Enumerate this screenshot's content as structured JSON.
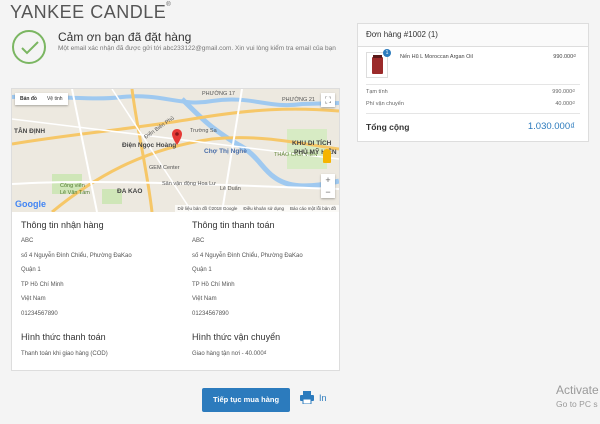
{
  "brand": {
    "logo_text": "YANKEE CANDLE",
    "trademark": "®"
  },
  "confirmation": {
    "title": "Cảm ơn bạn đã đặt hàng",
    "message": "Một email xác nhận đã được gửi tới abc233122@gmail.com. Xin vui lòng kiểm tra email của bạn"
  },
  "map": {
    "tab_map": "Bản đồ",
    "tab_satellite": "Vệ tinh",
    "labels": [
      "PHƯỜNG 17",
      "PHƯỜNG 21",
      "Điện Biên Phủ",
      "Trường Sa",
      "TÂN ĐỊNH",
      "Điện Ngọc Hoàng",
      "Chợ Thị Nghè",
      "KHU DI TÍCH",
      "THẢO CẦM VIÊN",
      "PHỦ MỸ HIỆN",
      "GEM Center",
      "ĐA KAO",
      "Công viên",
      "Lê Văn Tám",
      "Sân vận động Hoa Lư",
      "Lê Duẩn"
    ],
    "zoom_in": "+",
    "zoom_out": "−",
    "google_text": "Google",
    "footer": [
      "Dữ liệu bản đồ ©2018 Google",
      "Điều khoản sử dụng",
      "Báo cáo một lỗi bản đồ"
    ]
  },
  "shipping_info": {
    "title": "Thông tin nhận hàng",
    "name": "ABC",
    "address": "số 4 Nguyễn Đình Chiểu, Phường ĐaKao",
    "district": "Quận 1",
    "city": "TP Hồ Chí Minh",
    "country": "Việt Nam",
    "phone": "01234567890"
  },
  "billing_info": {
    "title": "Thông tin thanh toán",
    "name": "ABC",
    "address": "số 4 Nguyễn Đình Chiểu, Phường ĐaKao",
    "district": "Quận 1",
    "city": "TP Hồ Chí Minh",
    "country": "Việt Nam",
    "phone": "01234567890"
  },
  "payment": {
    "title": "Hình thức thanh toán",
    "value": "Thanh toán khi giao hàng (COD)"
  },
  "delivery": {
    "title": "Hình thức vận chuyển",
    "value": "Giao hàng tận nơi - 40.000₫"
  },
  "actions": {
    "continue_label": "Tiếp tục mua hàng",
    "print_label": "In"
  },
  "order": {
    "title": "Đơn hàng #1002 (1)",
    "item_name": "Nến Hũ L Moroccan Argan Oil",
    "item_price": "990.000₫",
    "item_qty": "1",
    "subtotal_label": "Tạm tính",
    "subtotal_value": "990.000₫",
    "shipping_label": "Phí vận chuyển",
    "shipping_value": "40.000₫",
    "total_label": "Tổng cộng",
    "total_value": "1.030.000₫"
  },
  "watermark": {
    "line1": "Activate",
    "line2": "Go to PC s"
  },
  "colors": {
    "primary": "#2c7bbd",
    "check": "#7bb662",
    "river": "#9fc9f0",
    "major_road": "#f6c768"
  }
}
